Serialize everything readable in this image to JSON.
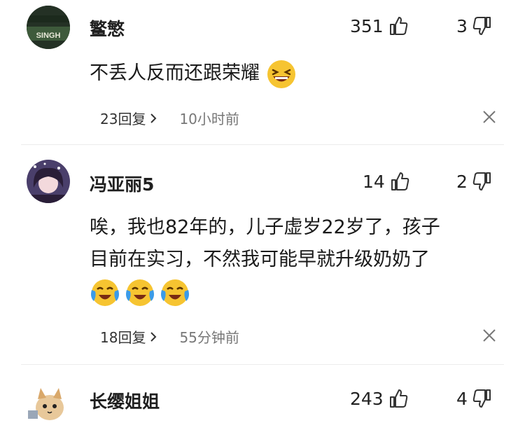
{
  "comments": [
    {
      "username": "鳘慜",
      "avatar_text": "SINGH",
      "likes": "351",
      "dislikes": "3",
      "text": "不丢人反而还跟荣耀",
      "reply_count": "23回复",
      "time": "10小时前"
    },
    {
      "username": "冯亚丽5",
      "likes": "14",
      "dislikes": "2",
      "text_line1": "唉，我也82年的，儿子虚岁22岁了，孩子",
      "text_line2": "目前在实习，不然我可能早就升级奶奶了",
      "reply_count": "18回复",
      "time": "55分钟前"
    },
    {
      "username": "长缨姐姐",
      "likes": "243",
      "dislikes": "4"
    }
  ],
  "icons": {
    "like": "thumbs-up-icon",
    "dislike": "thumbs-down-icon",
    "chevron": "chevron-right-icon",
    "close": "close-icon"
  },
  "colors": {
    "emoji_yellow": "#f6c431",
    "tear_blue": "#3b9be8"
  }
}
